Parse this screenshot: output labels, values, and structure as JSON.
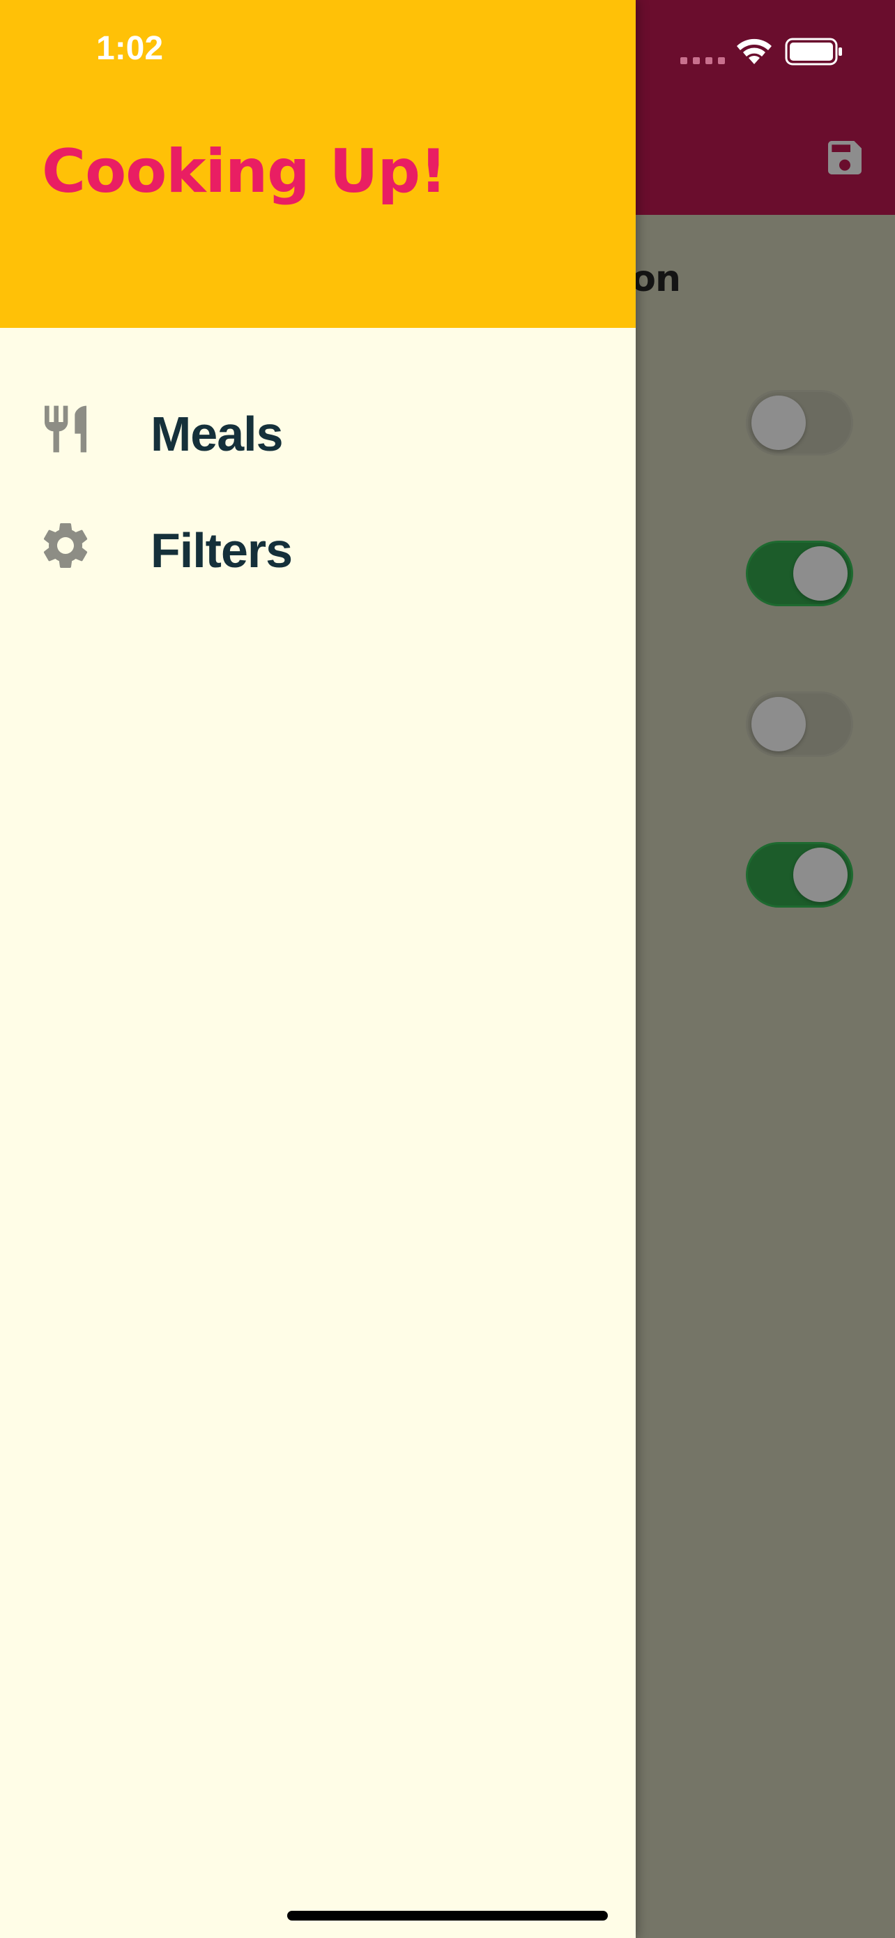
{
  "status_bar": {
    "time": "1:02"
  },
  "drawer": {
    "title": "Cooking Up!",
    "items": [
      {
        "label": "Meals",
        "icon": "restaurant-icon"
      },
      {
        "label": "Filters",
        "icon": "settings-gear-icon"
      }
    ]
  },
  "background_page": {
    "title_fragment": "on",
    "action_icon": "save-icon",
    "switches": [
      {
        "state": "off"
      },
      {
        "state": "on"
      },
      {
        "state": "off"
      },
      {
        "state": "on"
      }
    ]
  },
  "colors": {
    "drawer_header": "#ffc107",
    "drawer_title": "#e91e63",
    "drawer_body": "#fffde7",
    "app_bar": "#6a0d2d",
    "switch_on": "#1c5c2a",
    "label_text": "#15303a"
  }
}
